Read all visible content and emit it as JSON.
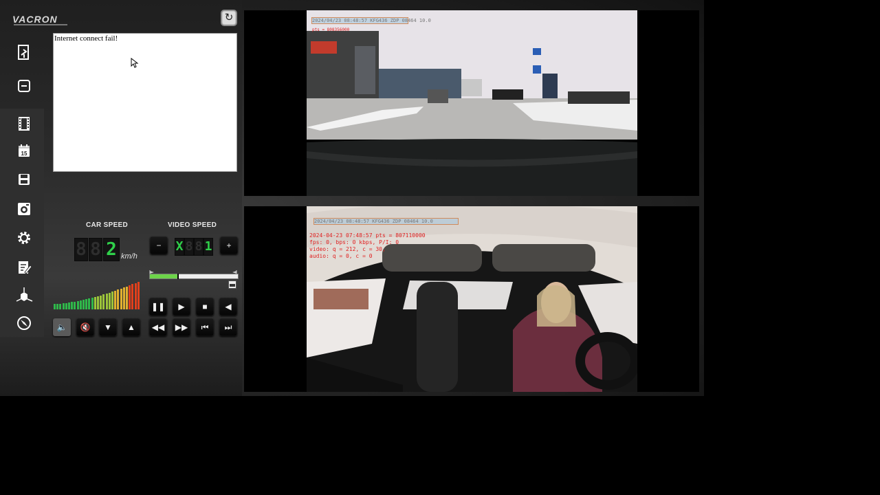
{
  "brand": {
    "logo_text": "VACRON"
  },
  "message_box": {
    "text": "Internet connect fail!"
  },
  "car_speed": {
    "label": "CAR SPEED",
    "digits": [
      "8",
      "8",
      "2"
    ],
    "unit": "km/h"
  },
  "video_speed": {
    "label": "VIDEO SPEED",
    "digits": [
      "X",
      "8",
      "8",
      "1"
    ],
    "minus_label": "−",
    "plus_label": "+"
  },
  "playback": {
    "progress": 0.32
  },
  "colors": {
    "accent_green": "#2fd04a",
    "osd_red": "#e02020"
  },
  "icons": {
    "refresh": "refresh-icon",
    "sidebar": [
      "exit-icon",
      "minimize-icon",
      "film-icon",
      "calendar-icon",
      "save-icon",
      "snapshot-icon",
      "settings-icon",
      "edit-icon",
      "axis-icon",
      "compass-icon"
    ],
    "calendar_day": "15"
  },
  "cameras": {
    "front": {
      "osd_timestamp": "2024/04/23 08:48:57 KFG436   ZDP 08464 10.0",
      "osd_line": "pts = 808356000"
    },
    "cabin": {
      "osd_timestamp": "2024/04/23 08:48:57 KFG436   ZDP 08464 10.0",
      "osd_lines": [
        "2024-04-23 07:48:57 pts = 807110000",
        "fps:  0, bps:    0 kbps, P/I:  0",
        "video: q = 212, c = 30,",
        "audio: q =  0, c =  0"
      ]
    }
  }
}
